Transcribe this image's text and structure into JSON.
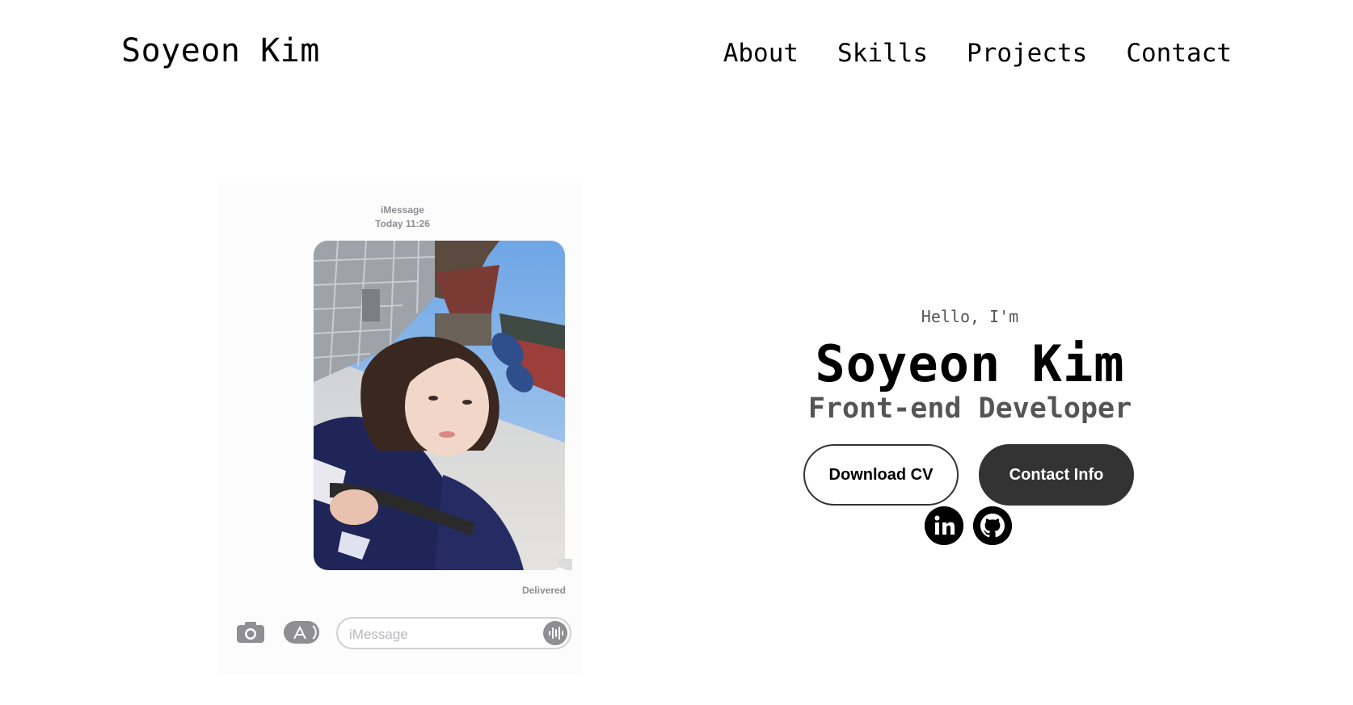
{
  "header": {
    "logo": "Soyeon Kim",
    "nav": [
      "About",
      "Skills",
      "Projects",
      "Contact"
    ]
  },
  "phone": {
    "service": "iMessage",
    "timestamp": "Today 11:26",
    "status": "Delivered",
    "input_placeholder": "iMessage",
    "icons": [
      "camera-icon",
      "app-store-icon",
      "audio-waveform-icon"
    ]
  },
  "hero": {
    "greeting": "Hello, I'm",
    "name": "Soyeon Kim",
    "role": "Front-end Developer",
    "buttons": {
      "download_cv": "Download CV",
      "contact_info": "Contact Info"
    },
    "social": [
      "linkedin-icon",
      "github-icon"
    ]
  },
  "colors": {
    "dark_button": "#333333",
    "subtitle": "#555555",
    "imessage_gray": "#8e8e93"
  }
}
